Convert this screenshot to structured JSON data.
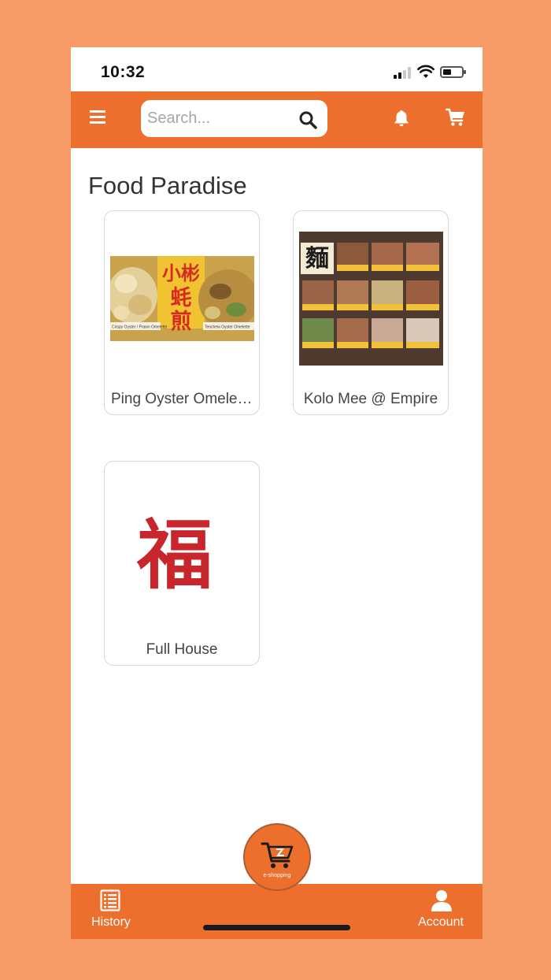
{
  "status_bar": {
    "time": "10:32"
  },
  "header": {
    "search_placeholder": "Search...",
    "icons": [
      "menu-icon",
      "search-icon",
      "bell-icon",
      "cart-icon"
    ]
  },
  "page": {
    "title": "Food Paradise"
  },
  "stores": [
    {
      "name": "Ping Oyster Omelette",
      "image_caption_left": "Crispy Oyster / Prawn Omelette",
      "image_caption_right": "Teochew Oyster Omelette"
    },
    {
      "name": "Kolo Mee @ Empire"
    },
    {
      "name": "Full House"
    }
  ],
  "bottom_nav": {
    "history_label": "History",
    "center_label": "e-shopping",
    "account_label": "Account"
  },
  "colors": {
    "brand": "#EC6F2E",
    "background": "#F79B67"
  }
}
